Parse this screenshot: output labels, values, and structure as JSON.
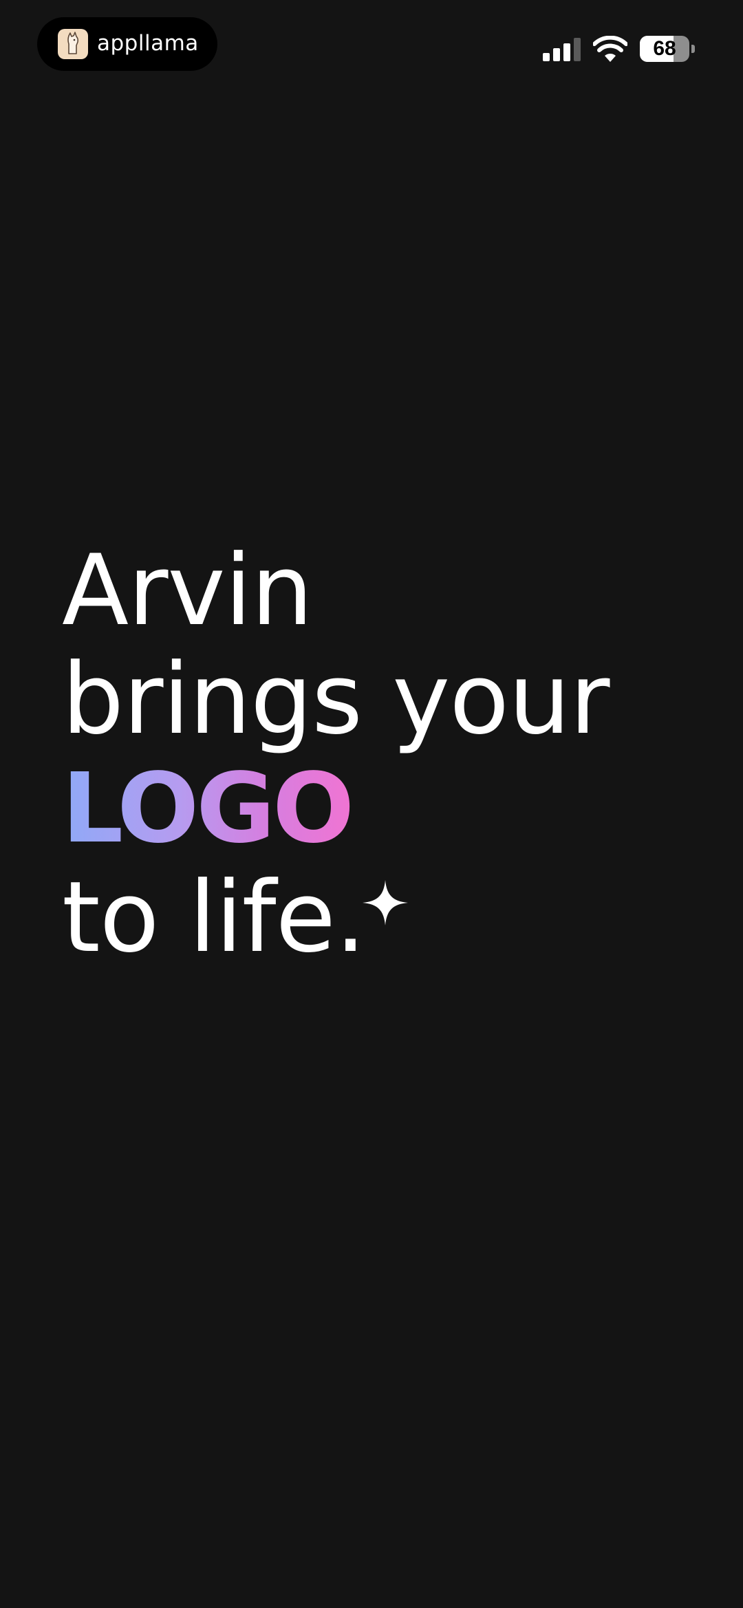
{
  "status_bar": {
    "app_name": "appllama",
    "app_icon": "llama-icon",
    "signal_icon": "cellular-signal-icon",
    "wifi_icon": "wifi-icon",
    "battery_level": 68,
    "battery_label": "68"
  },
  "headline": {
    "line1": "Arvin",
    "line2": "brings your",
    "line3": "LOGO",
    "line4": "to life.",
    "sparkle_icon": "sparkle-icon"
  },
  "colors": {
    "background": "#141414",
    "text": "#ffffff",
    "gradient_start": "#8fa9f7",
    "gradient_end": "#f074d2"
  }
}
